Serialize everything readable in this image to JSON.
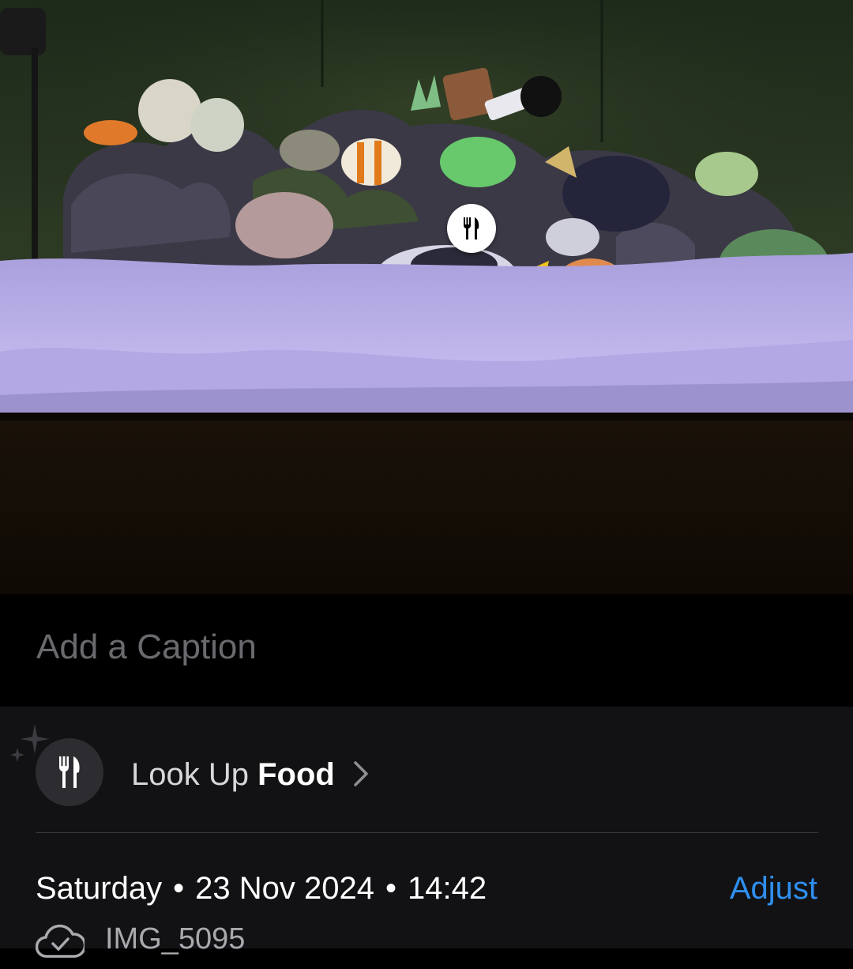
{
  "photo": {
    "description_icon": "aquarium-photo"
  },
  "visual_lookup_badge": {
    "icon": "fork-knife-icon"
  },
  "caption": {
    "placeholder": "Add a Caption"
  },
  "lookup": {
    "prefix": "Look Up",
    "subject": "Food",
    "icon": "fork-knife-icon",
    "sparkle_icon": "sparkle-icon",
    "chevron_icon": "chevron-right-icon"
  },
  "metadata": {
    "day": "Saturday",
    "date": "23 Nov 2024",
    "time": "14:42",
    "separator": "•",
    "adjust_label": "Adjust",
    "file_name": "IMG_5095",
    "file_icon": "icloud-check-icon"
  },
  "colors": {
    "accent": "#2f8ff0",
    "panel": "#121214",
    "background": "#000000"
  }
}
